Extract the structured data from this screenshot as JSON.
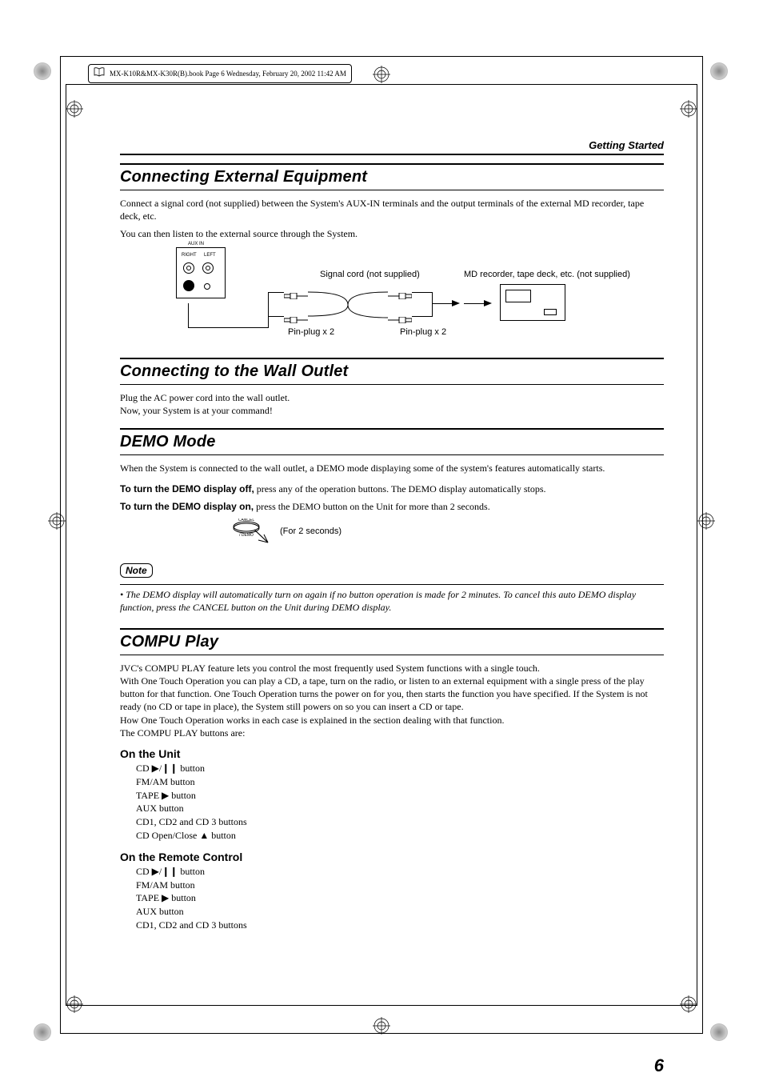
{
  "running_head": "MX-K10R&MX-K30R(B).book  Page 6  Wednesday, February 20, 2002  11:42 AM",
  "section_header": "Getting Started",
  "sec1": {
    "title": "Connecting External Equipment",
    "p1": "Connect a signal cord (not supplied) between the System's AUX-IN terminals and the output terminals of the external MD recorder, tape deck, etc.",
    "p2": "You can then listen to the external source through the System.",
    "diagram": {
      "aux_in": "AUX IN",
      "right": "RIGHT",
      "left": "LEFT",
      "signal_cord": "Signal cord (not supplied)",
      "md_label": "MD recorder, tape deck, etc. (not supplied)",
      "pin_plug": "Pin-plug x 2"
    }
  },
  "sec2": {
    "title": "Connecting to the Wall Outlet",
    "p1": "Plug the AC power cord into the wall outlet.",
    "p2": "Now, your System is at your command!"
  },
  "sec3": {
    "title": "DEMO Mode",
    "p1": "When the System is connected to the wall outlet, a DEMO mode displaying some of the system's features automatically starts.",
    "off_label": "To turn the DEMO display off,",
    "off_text": " press any of the operation buttons. The DEMO display automatically stops.",
    "on_label": "To turn the DEMO display on,",
    "on_text": " press the DEMO button on the Unit for more than 2 seconds.",
    "cancel": "CANCEL",
    "demo": "/ DEMO",
    "for2sec": "(For 2 seconds)",
    "note_label": "Note",
    "note_text": "The DEMO display will automatically turn on again if no button operation is made for 2 minutes. To cancel this auto DEMO display function, press the CANCEL button on the Unit during DEMO display."
  },
  "sec4": {
    "title": "COMPU Play",
    "p1": "JVC's COMPU PLAY feature lets you control the most frequently used System functions with a single touch.",
    "p2": "With One Touch Operation you can play a CD, a tape, turn on the radio, or listen to an external equipment with a single press of the play button for that function. One Touch Operation turns the power on for you, then starts the function you have specified. If the System is not ready (no CD or tape in place), the System still powers on so you can insert a CD or tape.",
    "p3": "How One Touch Operation works in each case is explained in the section dealing with that function.",
    "p4": "The COMPU PLAY buttons are:",
    "unit_h": "On the Unit",
    "unit_items": {
      "i1": "CD ▶/❙❙ button",
      "i2": "FM/AM button",
      "i3": "TAPE ▶ button",
      "i4": "AUX button",
      "i5": "CD1, CD2 and CD 3 buttons",
      "i6": "CD Open/Close ▲ button"
    },
    "rc_h": "On the Remote Control",
    "rc_items": {
      "i1": "CD ▶/❙❙ button",
      "i2": "FM/AM button",
      "i3": "TAPE ▶ button",
      "i4": "AUX button",
      "i5": "CD1, CD2 and CD 3 buttons"
    }
  },
  "page_number": "6"
}
